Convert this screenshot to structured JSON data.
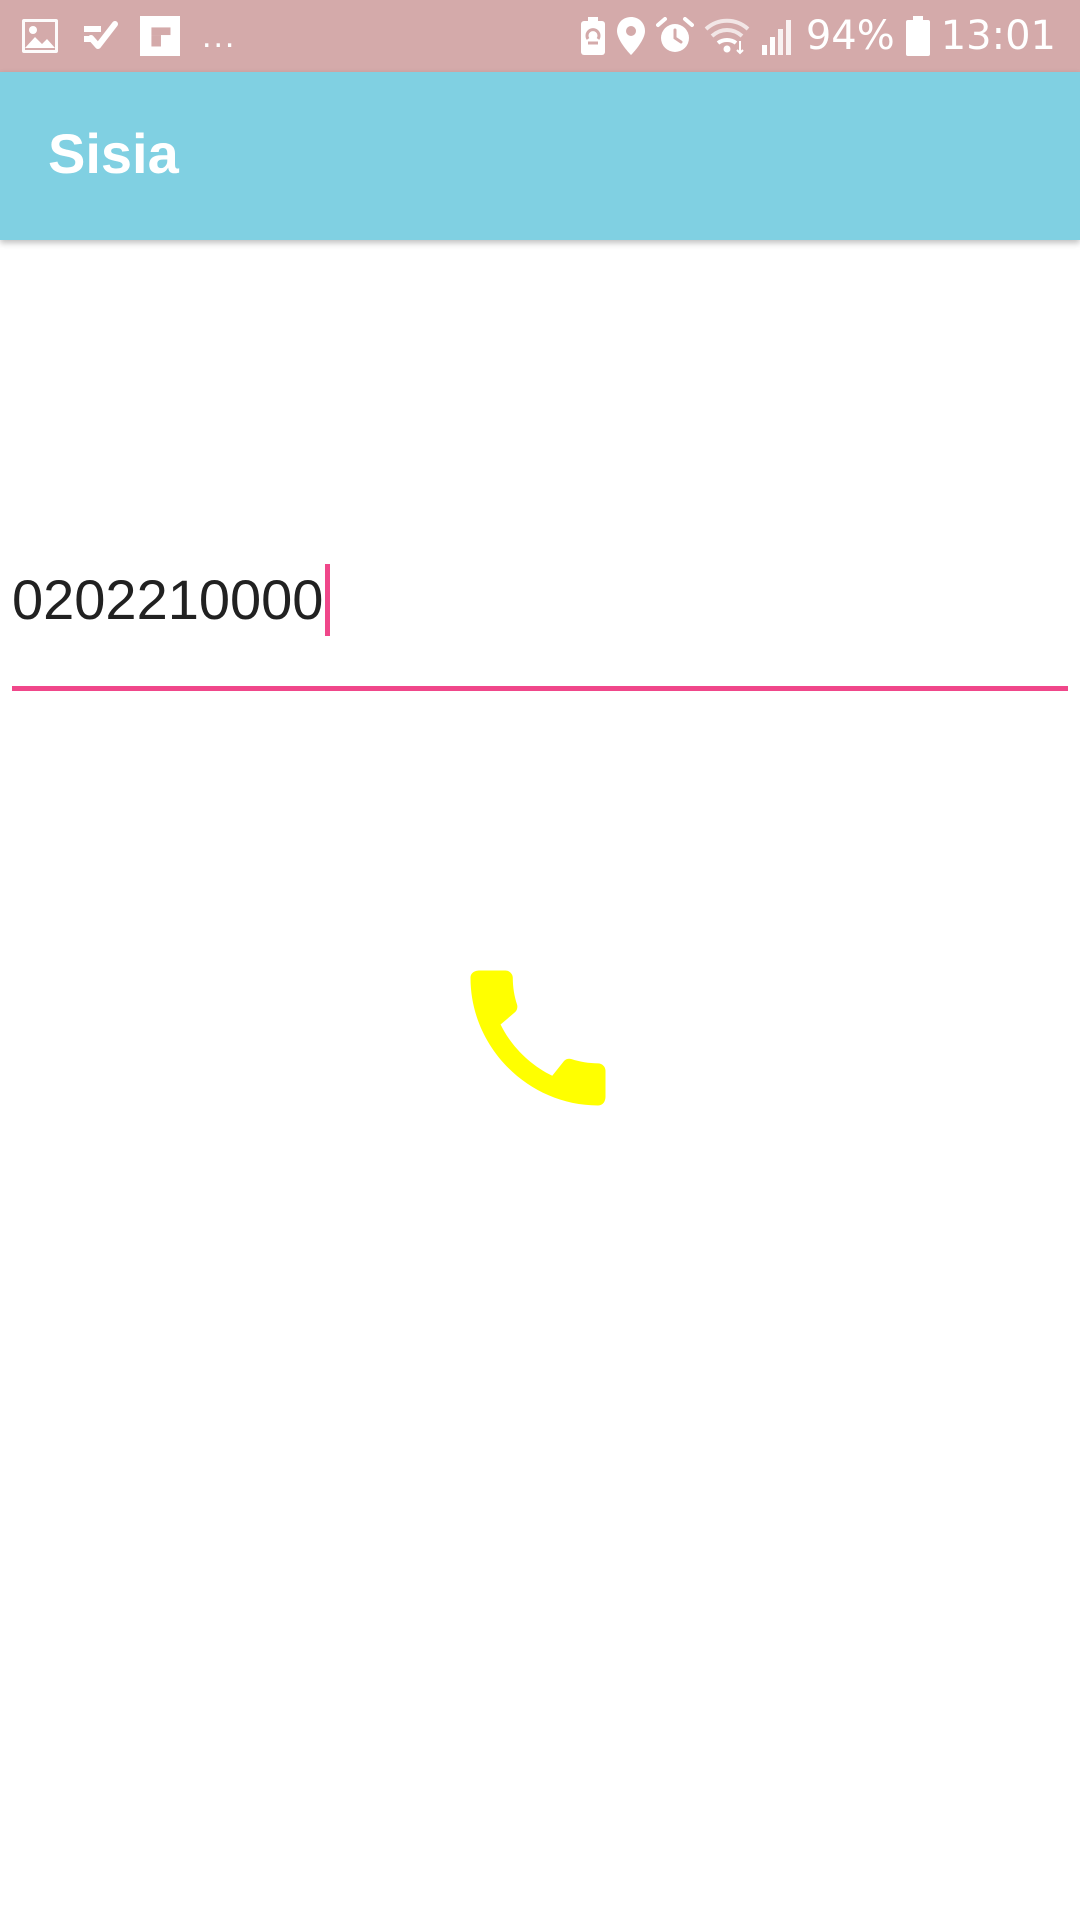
{
  "status_bar": {
    "battery_percent": "94%",
    "time": "13:01",
    "more_indicator": "...",
    "left_icons": [
      "gallery-icon",
      "task-check-icon",
      "flipboard-icon"
    ],
    "right_icons": [
      "battery-saver-icon",
      "location-icon",
      "alarm-icon",
      "wifi-icon",
      "signal-icon",
      "battery-icon"
    ],
    "background_color": "#d4aaaa"
  },
  "app_bar": {
    "title": "Sisia",
    "background_color": "#80d0e2"
  },
  "phone_input": {
    "value": "0202210000",
    "accent_color": "#f0478a"
  },
  "call_button": {
    "icon": "phone-icon",
    "color": "#ffff00"
  }
}
